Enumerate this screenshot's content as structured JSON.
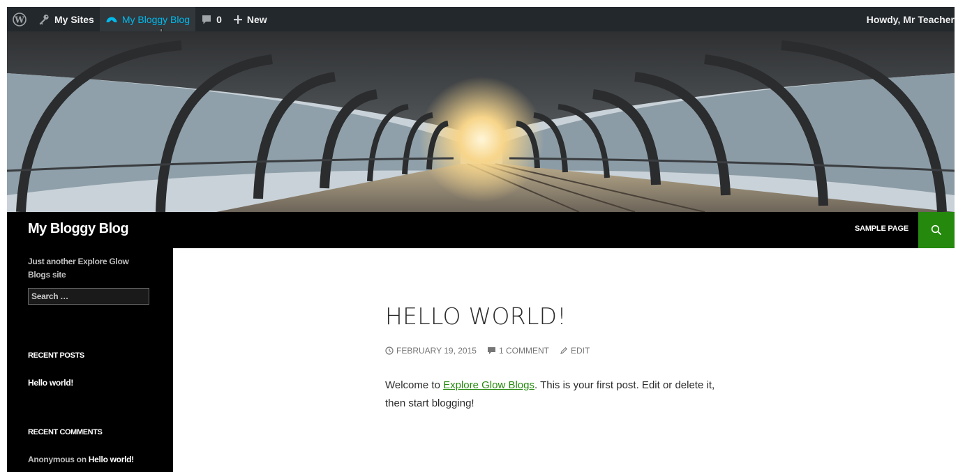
{
  "adminbar": {
    "wp_logo_icon": "wordpress-logo-icon",
    "my_sites": "My Sites",
    "site_name": "My Bloggy Blog",
    "comments_count": "0",
    "new_label": "New",
    "howdy": "Howdy, Mr Teacher"
  },
  "site": {
    "title": "My Bloggy Blog",
    "tagline": "Just another Explore Glow Blogs site",
    "nav": [
      "SAMPLE PAGE"
    ]
  },
  "sidebar": {
    "search_placeholder": "Search …",
    "recent_posts_title": "RECENT POSTS",
    "recent_posts": [
      "Hello world!"
    ],
    "recent_comments_title": "RECENT COMMENTS",
    "recent_comments": [
      {
        "author": "Anonymous",
        "connector": " on ",
        "post": "Hello world!"
      }
    ]
  },
  "post": {
    "title": "HELLO WORLD!",
    "date": "FEBRUARY 19, 2015",
    "comments": "1 COMMENT",
    "edit": "EDIT",
    "body_before": "Welcome to ",
    "body_link": "Explore Glow Blogs",
    "body_after": ". This is your first post. Edit or delete it, then start blogging!"
  },
  "colors": {
    "accent": "#24890d",
    "adminbar_bg": "#23282d",
    "adminbar_active": "#00b9eb"
  }
}
